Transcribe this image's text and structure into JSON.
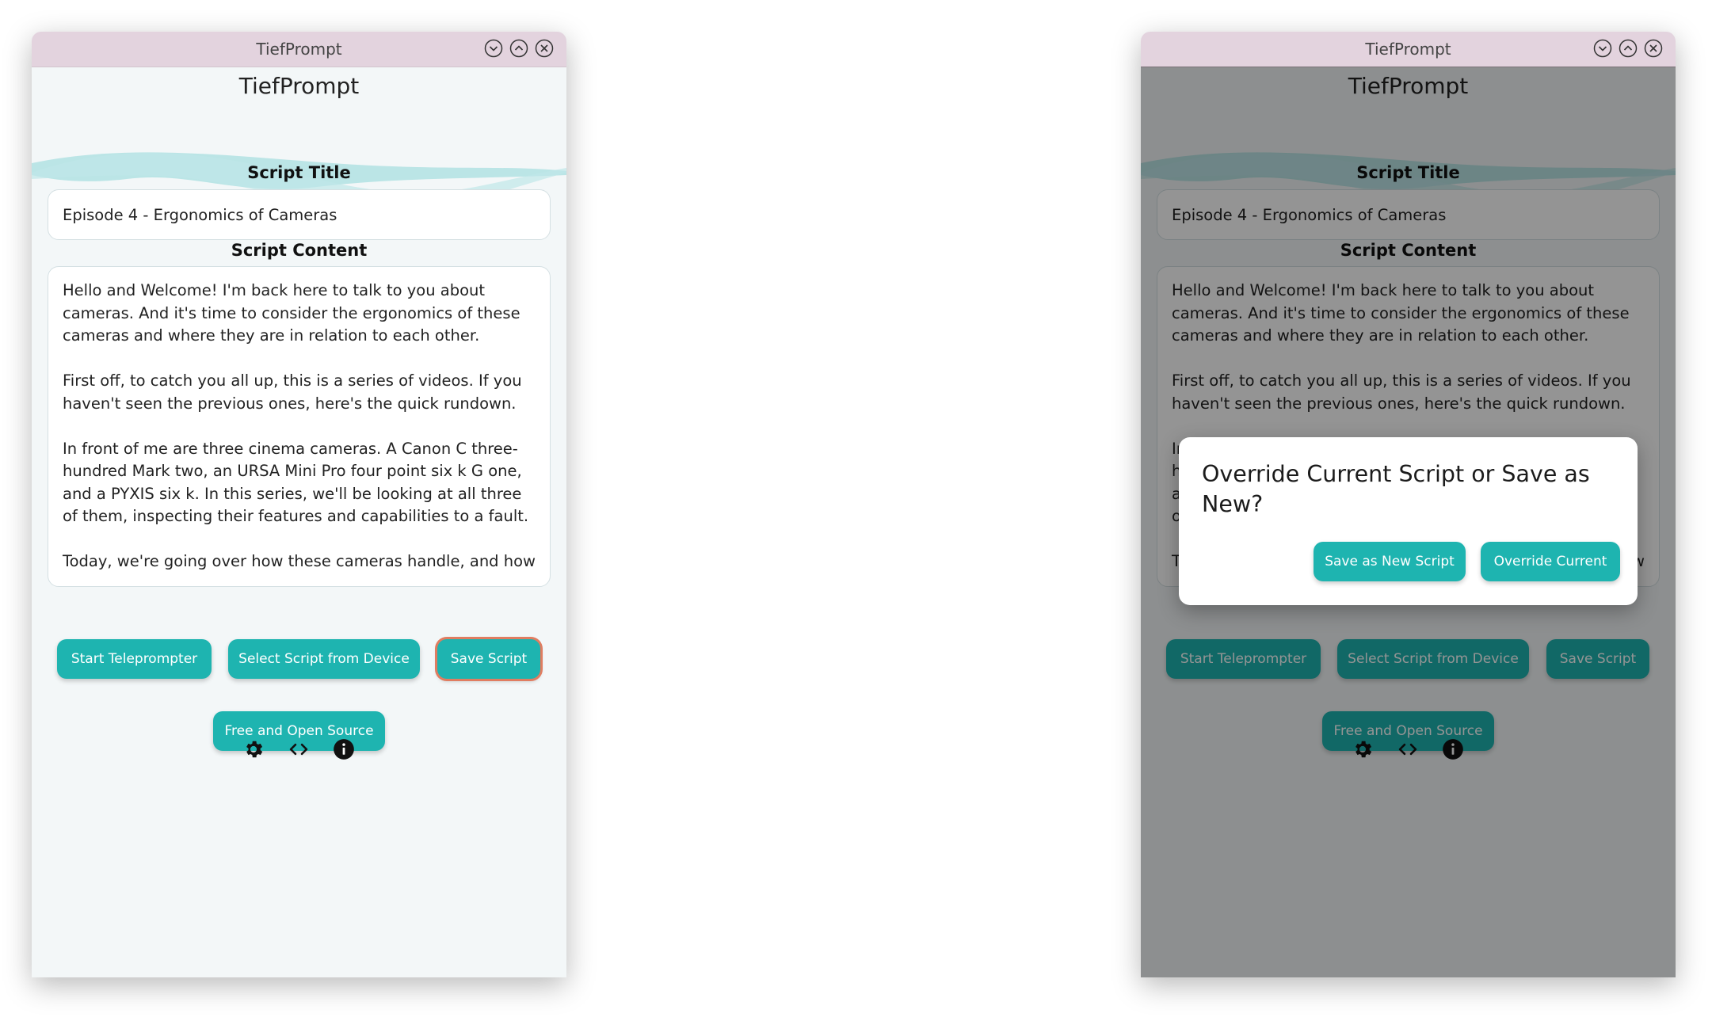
{
  "window": {
    "title": "TiefPrompt",
    "controls": [
      "minimize-icon",
      "maximize-icon",
      "close-icon"
    ]
  },
  "app": {
    "title": "TiefPrompt",
    "script_title_label": "Script Title",
    "script_title_value": "Episode 4 - Ergonomics of Cameras",
    "script_content_label": "Script Content",
    "script_content_value": "Hello and Welcome! I'm back here to talk to you about cameras. And it's time to consider the ergonomics of these cameras and where they are in relation to each other.\n\nFirst off, to catch you all up, this is a series of videos. If you haven't seen the previous ones, here's the quick rundown.\n\nIn front of me are three cinema cameras. A Canon C three-hundred Mark two, an URSA Mini Pro four point six k G one, and a PYXIS six k. In this series, we'll be looking at all three of them, inspecting their features and capabilities to a fault.\n\nToday, we're going over how these cameras handle, and how",
    "buttons": {
      "start": "Start Teleprompter",
      "select": "Select Script from Device",
      "save": "Save Script",
      "foss": "Free and Open Source"
    },
    "footer_icons": [
      "gear-icon",
      "code-icon",
      "info-icon"
    ]
  },
  "dialog": {
    "title": "Override Current Script or Save as New?",
    "save_new": "Save as New Script",
    "override": "Override Current"
  },
  "colors": {
    "accent": "#1eb4b0",
    "titlebar": "#e3d3de",
    "focus_ring": "#e07d61",
    "background": "#f3f7f8"
  }
}
